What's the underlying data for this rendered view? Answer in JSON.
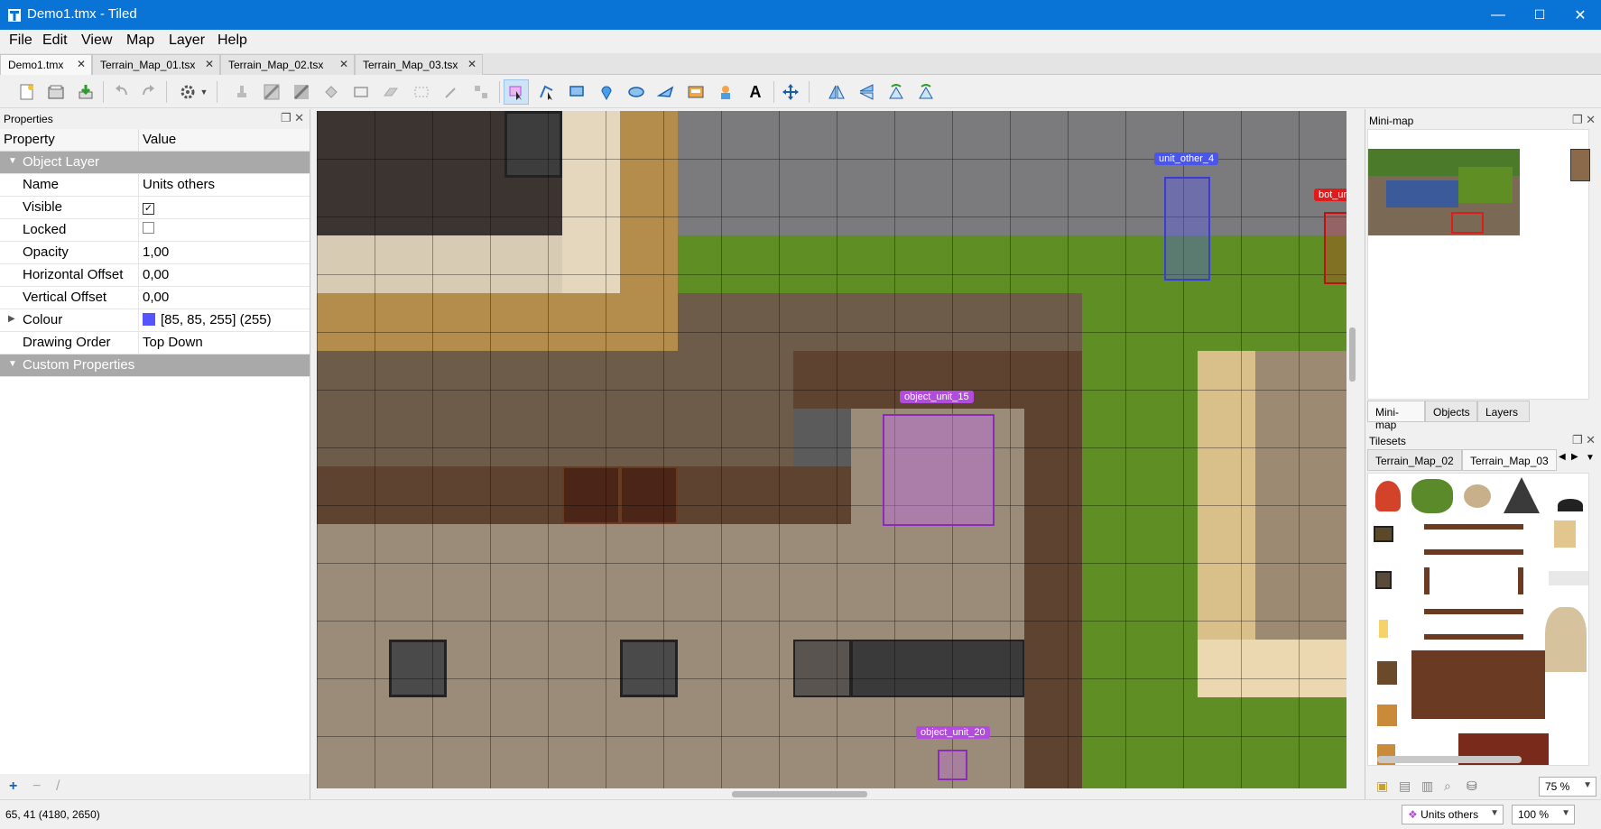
{
  "window": {
    "title": "Demo1.tmx - Tiled",
    "minimize": "—",
    "maximize": "☐",
    "close": "✕"
  },
  "menu": {
    "file": "File",
    "edit": "Edit",
    "view": "View",
    "map": "Map",
    "layer": "Layer",
    "help": "Help"
  },
  "tabs": [
    {
      "label": "Demo1.tmx",
      "active": true
    },
    {
      "label": "Terrain_Map_01.tsx",
      "active": false
    },
    {
      "label": "Terrain_Map_02.tsx",
      "active": false
    },
    {
      "label": "Terrain_Map_03.tsx",
      "active": false
    }
  ],
  "toolbar": {
    "icons": [
      "new-map-icon",
      "open-file-icon",
      "save-icon",
      "undo-icon",
      "redo-icon",
      "commands-icon",
      "stamp-brush-icon",
      "terrain-brush-icon",
      "wang-brush-icon",
      "bucket-fill-icon",
      "shape-fill-icon",
      "eraser-icon",
      "rectangular-select-icon",
      "magic-wand-icon",
      "select-same-tile-icon",
      "select-objects-icon",
      "edit-polygons-icon",
      "insert-rectangle-icon",
      "insert-point-icon",
      "insert-ellipse-icon",
      "insert-polygon-icon",
      "insert-tile-icon",
      "insert-template-icon",
      "insert-text-icon",
      "random-mode-icon",
      "flip-horizontal-icon",
      "flip-vertical-icon",
      "rotate-left-icon",
      "rotate-right-icon"
    ]
  },
  "properties": {
    "panel_title": "Properties",
    "col_property": "Property",
    "col_value": "Value",
    "group_object_layer": "Object Layer",
    "rows": [
      {
        "key": "Name",
        "value": "Units others"
      },
      {
        "key": "Visible",
        "value": "✓"
      },
      {
        "key": "Locked",
        "value": ""
      },
      {
        "key": "Opacity",
        "value": "1,00"
      },
      {
        "key": "Horizontal Offset",
        "value": "0,00"
      },
      {
        "key": "Vertical Offset",
        "value": "0,00"
      },
      {
        "key": "Colour",
        "value": "[85, 85, 255] (255)"
      },
      {
        "key": "Drawing Order",
        "value": "Top Down"
      }
    ],
    "group_custom": "Custom Properties",
    "colour_hex": "#5555ff",
    "add_icon": "+",
    "remove_icon": "−",
    "rename_icon": "/"
  },
  "map": {
    "objects": [
      {
        "label": "unit_other_4",
        "color": "#4a55ee"
      },
      {
        "label": "bot_ur",
        "color": "#e01b1b"
      },
      {
        "label": "object_unit_15",
        "color": "#b24cdc"
      },
      {
        "label": "object_unit_20",
        "color": "#b24cdc"
      }
    ]
  },
  "minimap": {
    "title": "Mini-map"
  },
  "right_tabs": [
    "Mini-map",
    "Objects",
    "Layers"
  ],
  "tilesets": {
    "title": "Tilesets",
    "tabs": [
      "Terrain_Map_02",
      "Terrain_Map_03"
    ]
  },
  "status": {
    "coords": "65, 41 (4180, 2650)",
    "layer_combo": "Units others",
    "zoom_combo": "100 %",
    "tileset_zoom": "75 %"
  },
  "colors": {
    "titlebar": "#0a74d6",
    "accent": "#0a74d6"
  }
}
